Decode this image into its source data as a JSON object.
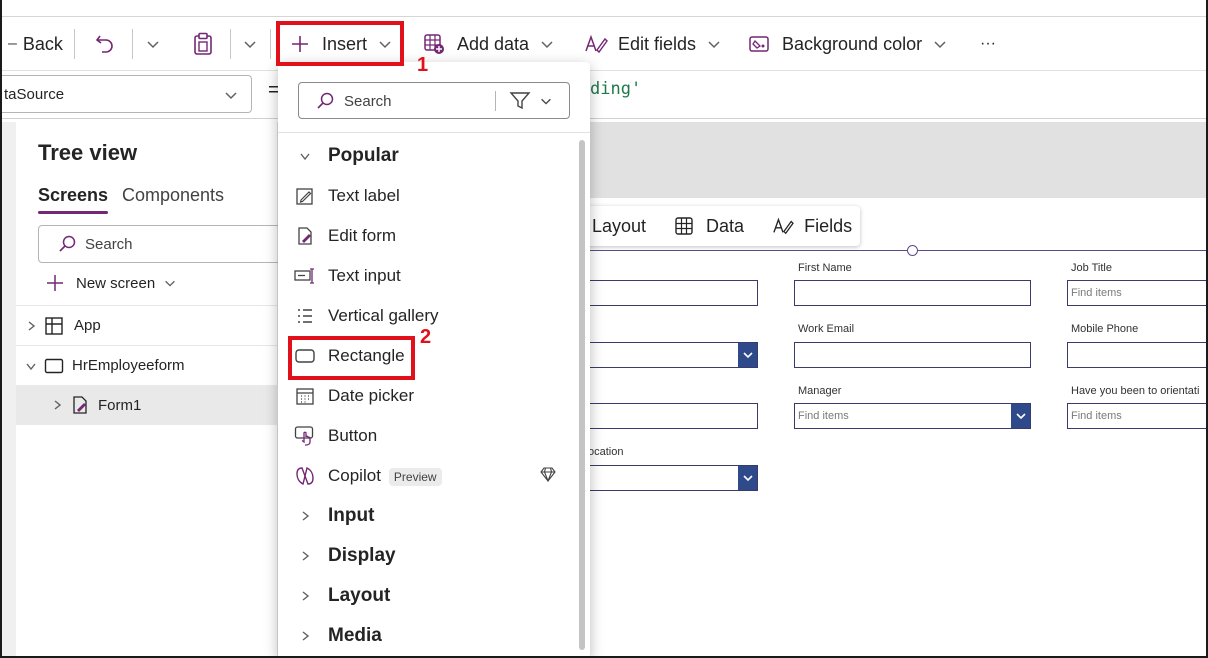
{
  "toolbar": {
    "back": "Back",
    "insert": "Insert",
    "add_data": "Add data",
    "edit_fields": "Edit fields",
    "background_color": "Background color",
    "more": "···"
  },
  "formula_bar": {
    "property": "taSource",
    "equals": "=",
    "formula": "ding'"
  },
  "tree_view": {
    "title": "Tree view",
    "tabs": [
      "Screens",
      "Components"
    ],
    "search_placeholder": "Search",
    "new_screen": "New screen",
    "items": [
      {
        "label": "App"
      },
      {
        "label": "HrEmployeeform"
      },
      {
        "label": "Form1"
      }
    ]
  },
  "insert_menu": {
    "search_placeholder": "Search",
    "popular_label": "Popular",
    "items": [
      {
        "label": "Text label",
        "icon": "text-label-icon"
      },
      {
        "label": "Edit form",
        "icon": "edit-form-icon"
      },
      {
        "label": "Text input",
        "icon": "text-input-icon"
      },
      {
        "label": "Vertical gallery",
        "icon": "vertical-gallery-icon"
      },
      {
        "label": "Rectangle",
        "icon": "rectangle-icon"
      },
      {
        "label": "Date picker",
        "icon": "date-picker-icon"
      },
      {
        "label": "Button",
        "icon": "button-icon"
      },
      {
        "label": "Copilot",
        "icon": "copilot-icon",
        "badge": "Preview"
      }
    ],
    "categories": [
      "Input",
      "Display",
      "Layout",
      "Media"
    ]
  },
  "form_toolbar": {
    "layout": "Layout",
    "data": "Data",
    "fields": "Fields"
  },
  "form": {
    "first_name": "First Name",
    "job_title": "Job Title",
    "work_email": "Work Email",
    "mobile_phone": "Mobile Phone",
    "manager": "Manager",
    "orientation": "Have you been to orientati",
    "location": "ocation",
    "find_items": "Find items"
  },
  "annotations": {
    "step1": "1",
    "step2": "2"
  },
  "colors": {
    "accent": "#742774",
    "highlight": "#e0111b",
    "dropdown_button": "#2e4a8a"
  }
}
